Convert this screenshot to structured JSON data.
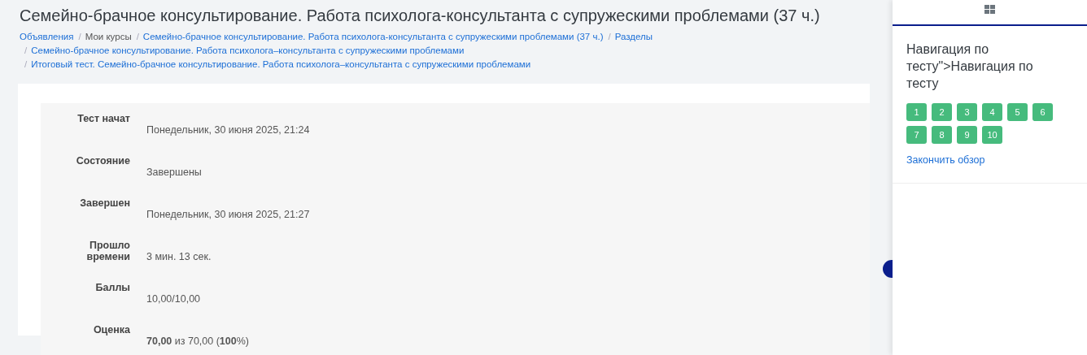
{
  "page_title": "Семейно-брачное консультирование. Работа психолога-консультанта с супружескими проблемами (37 ч.)",
  "breadcrumb": {
    "separator": "/",
    "items": [
      {
        "label": "Объявления",
        "link": true
      },
      {
        "label": "Мои курсы",
        "link": false
      },
      {
        "label": "Семейно-брачное консультирование. Работа психолога-консультанта с супружескими проблемами (37 ч.)",
        "link": true
      },
      {
        "label": "Разделы",
        "link": true
      },
      {
        "label": "Семейно-брачное консультирование. Работа психолога–консультанта с супружескими проблемами",
        "link": true
      },
      {
        "label": "Итоговый тест. Семейно-брачное консультирование. Работа психолога–консультанта с супружескими проблемами",
        "link": true
      }
    ]
  },
  "summary": [
    {
      "label": "Тест начат",
      "value": "Понедельник, 30 июня 2025, 21:24"
    },
    {
      "label": "Состояние",
      "value": "Завершены"
    },
    {
      "label": "Завершен",
      "value": "Понедельник, 30 июня 2025, 21:27"
    },
    {
      "label": "Прошло времени",
      "value": "3 мин. 13 сек."
    },
    {
      "label": "Баллы",
      "value": "10,00/10,00"
    },
    {
      "label": "Оценка",
      "value": "**70,00** из 70,00 (**100**%)"
    }
  ],
  "drawer": {
    "title": "Навигация по тесту\">Навигация по тесту",
    "questions": [
      {
        "label": "1",
        "correct": true
      },
      {
        "label": "2",
        "correct": true
      },
      {
        "label": "3",
        "correct": true
      },
      {
        "label": "4",
        "correct": true
      },
      {
        "label": "5",
        "correct": true
      },
      {
        "label": "6",
        "correct": true
      },
      {
        "label": "7",
        "correct": true
      },
      {
        "label": "8",
        "correct": true
      },
      {
        "label": "9",
        "correct": true
      },
      {
        "label": "10",
        "correct": true
      }
    ],
    "finish_link": "Закончить обзор"
  }
}
